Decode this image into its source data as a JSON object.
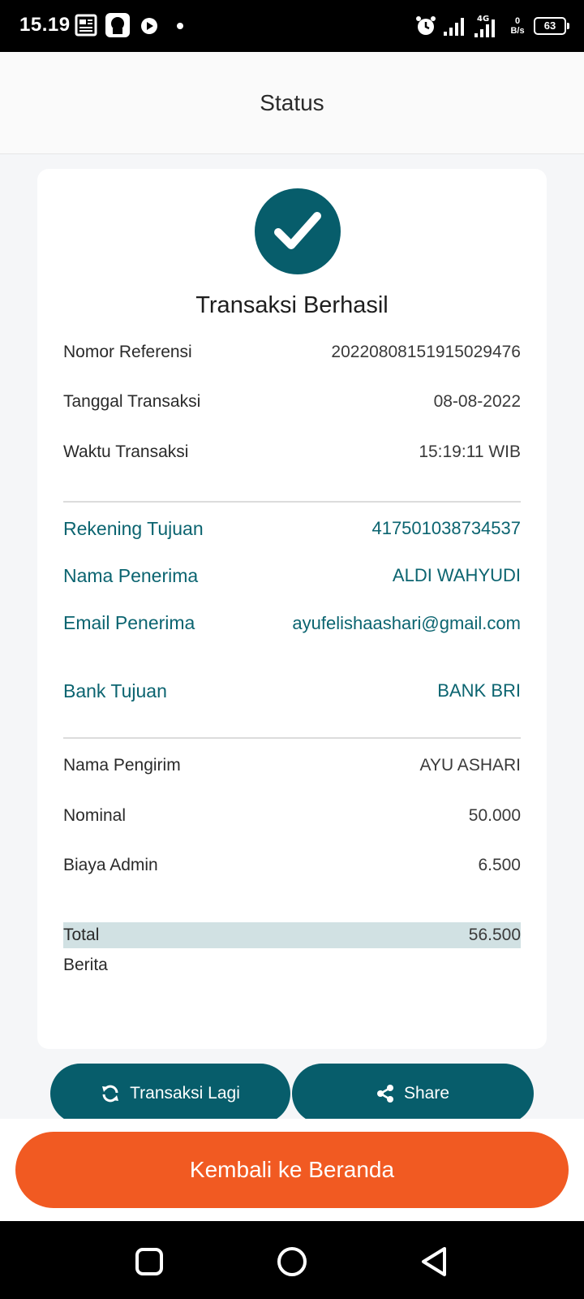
{
  "status_bar": {
    "time": "15.19",
    "network": "4G",
    "speed": "0 B/s",
    "battery": "63"
  },
  "header": {
    "title": "Status"
  },
  "result": {
    "title": "Transaksi Berhasil",
    "icon": "check-icon"
  },
  "details": {
    "ref_label": "Nomor Referensi",
    "ref_value": "20220808151915029476",
    "date_label": "Tanggal Transaksi",
    "date_value": "08-08-2022",
    "time_label": "Waktu Transaksi",
    "time_value": "15:19:11 WIB"
  },
  "recipient": {
    "account_label": "Rekening Tujuan",
    "account_value": "417501038734537",
    "name_label": "Nama Penerima",
    "name_value": "ALDI WAHYUDI",
    "email_label": "Email Penerima",
    "email_value": "ayufelishaashari@gmail.com",
    "bank_label": "Bank Tujuan",
    "bank_value": "BANK BRI"
  },
  "payment": {
    "sender_label": "Nama Pengirim",
    "sender_value": "AYU ASHARI",
    "nominal_label": "Nominal",
    "nominal_value": "50.000",
    "fee_label": "Biaya Admin",
    "fee_value": "6.500",
    "total_label": "Total",
    "total_value": "56.500",
    "note_label": "Berita",
    "note_value": ""
  },
  "actions": {
    "again_label": "Transaksi Lagi",
    "share_label": "Share",
    "home_label": "Kembali ke Beranda"
  },
  "colors": {
    "primary": "#075d6b",
    "accent": "#f15a22",
    "total_highlight": "#d1e1e3"
  }
}
